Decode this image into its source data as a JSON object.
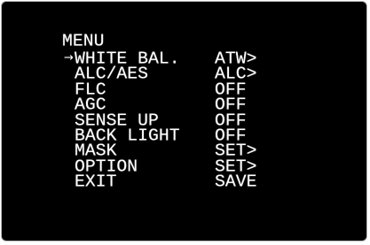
{
  "menu": {
    "title": "MENU",
    "cursor_icon": "right-arrow-icon",
    "cursor_glyph": "→",
    "selected_index": 0,
    "items": [
      {
        "label": "WHITE BAL.",
        "value": "ATW>"
      },
      {
        "label": "ALC/AES",
        "value": "ALC>"
      },
      {
        "label": "FLC",
        "value": "OFF"
      },
      {
        "label": "AGC",
        "value": "OFF"
      },
      {
        "label": "SENSE UP",
        "value": "OFF"
      },
      {
        "label": "BACK LIGHT",
        "value": "OFF"
      },
      {
        "label": "MASK",
        "value": "SET>"
      },
      {
        "label": "OPTION",
        "value": "SET>"
      },
      {
        "label": "EXIT",
        "value": "SAVE"
      }
    ]
  }
}
